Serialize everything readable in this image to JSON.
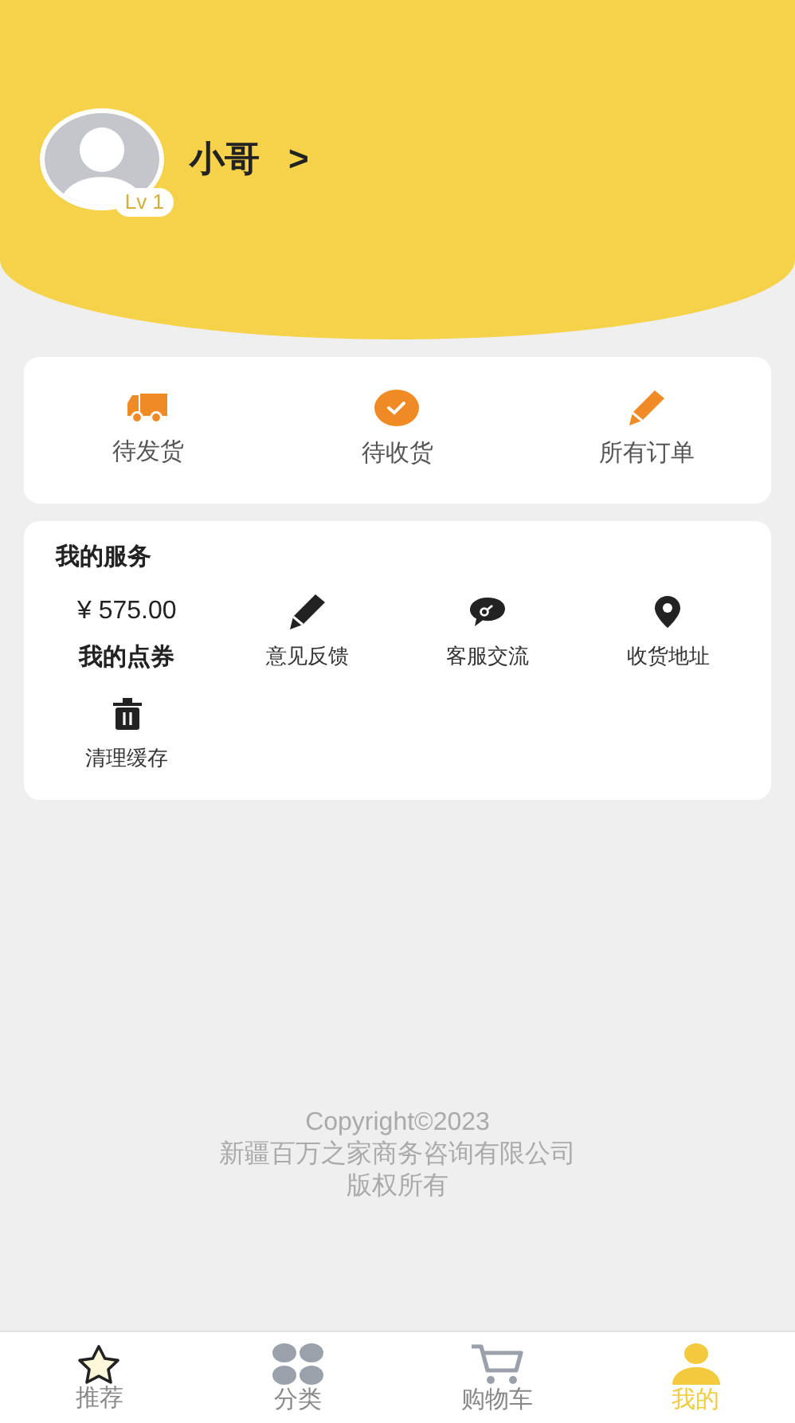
{
  "profile": {
    "name": "小哥",
    "chevron": ">",
    "level": "Lv 1"
  },
  "orders": [
    {
      "label": "待发货"
    },
    {
      "label": "待收货"
    },
    {
      "label": "所有订单"
    }
  ],
  "services": {
    "title": "我的服务",
    "items": [
      {
        "kind": "value",
        "value": "¥ 575.00",
        "label": "我的点券"
      },
      {
        "kind": "icon",
        "label": "意见反馈"
      },
      {
        "kind": "icon",
        "label": "客服交流"
      },
      {
        "kind": "icon",
        "label": "收货地址"
      },
      {
        "kind": "icon",
        "label": "清理缓存"
      }
    ]
  },
  "footer": [
    "Copyright©2023",
    "新疆百万之家商务咨询有限公司",
    "版权所有"
  ],
  "tabs": [
    {
      "label": "推荐",
      "selected": false
    },
    {
      "label": "分类",
      "selected": false
    },
    {
      "label": "购物车",
      "selected": false
    },
    {
      "label": "我的",
      "selected": true
    }
  ]
}
